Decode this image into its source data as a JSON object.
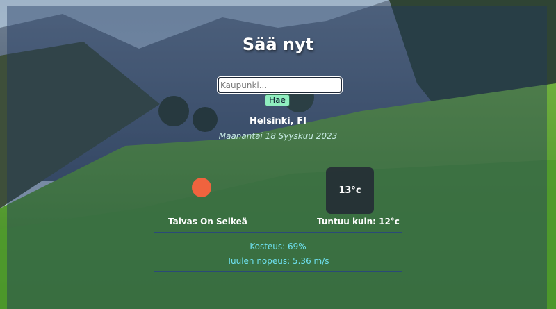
{
  "app": {
    "title": "Sää nyt"
  },
  "search": {
    "placeholder": "Kaupunki...",
    "value": "",
    "button_label": "Hae"
  },
  "location": {
    "city": "Helsinki, FI",
    "date": "Maanantai 18 Syyskuu 2023"
  },
  "weather": {
    "icon": "sun-icon",
    "description": "Taivas On Selkeä",
    "temperature": "13°c",
    "feels_like": "Tuntuu kuin: 12°c",
    "humidity": "Kosteus: 69%",
    "wind": "Tuulen nopeus: 5.36 m/s"
  },
  "colors": {
    "sun": "#f0633e",
    "search_button": "#90eebf",
    "stat_text": "#6ee0ef",
    "divider": "#2a4a78"
  }
}
